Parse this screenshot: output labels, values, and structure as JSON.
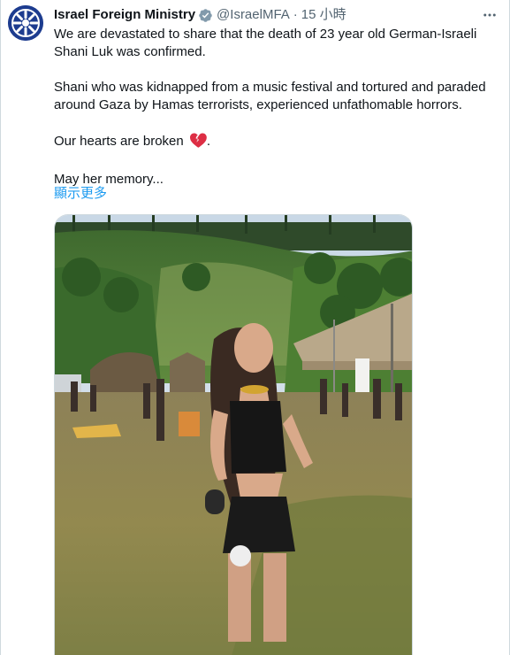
{
  "tweet": {
    "author_name": "Israel Foreign Ministry",
    "handle": "@IsraelMFA",
    "separator": "·",
    "time": "15 小時",
    "paragraphs": [
      "We are devastated to share that the death of 23 year old German-Israeli\nShani Luk was confirmed.",
      "Shani who was kidnapped from a music festival and tortured and paraded\naround Gaza by Hamas terrorists, experienced unfathomable horrors.",
      "Our hearts are broken",
      "May her memory..."
    ],
    "heart_suffix": ".",
    "show_more": "顯示更多"
  },
  "icons": {
    "avatar": "emblem-avatar-icon",
    "verified": "verified-badge-icon",
    "more": "more-options-icon",
    "broken_heart": "broken-heart-icon"
  },
  "colors": {
    "link": "#1d9bf0",
    "verified": "#829aab",
    "secondary_text": "#536471",
    "avatar_bg": "#1d3c8f"
  }
}
